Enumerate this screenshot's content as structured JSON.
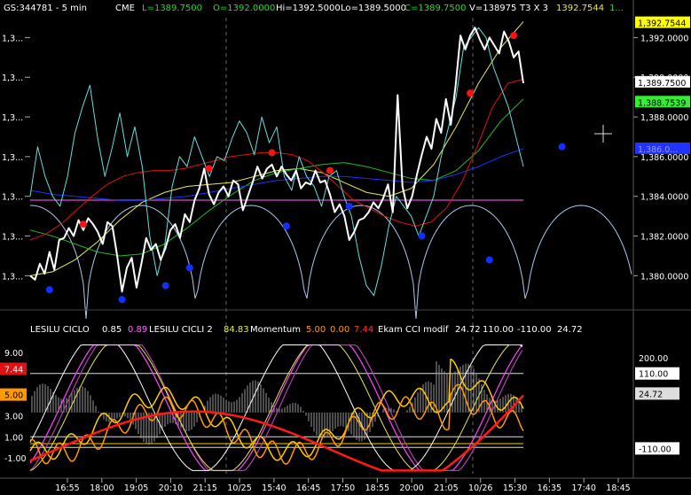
{
  "header": {
    "symbol": "GS:344781 - 5 min",
    "exchange": "CME",
    "last": "L=1389.7500",
    "open": "O=1392.0000",
    "high": "Hi=1392.5000",
    "low": "Lo=1389.5000",
    "close": "C=1389.7500",
    "volume": "V=138975",
    "t3": "T3 X 3",
    "t3_value": "1392.7544",
    "extra": "1..."
  },
  "indicator_header": {
    "ciclo_name": "LESILU CICLO",
    "ciclo_v1": "0.85",
    "ciclo_v2": "0.89",
    "cicli2_name": "LESILU CICLI 2",
    "cicli2_v": "84.83",
    "momentum_name": "Momentum",
    "momentum_v1": "5.00",
    "momentum_v2": "0.00",
    "momentum_v3": "7.44",
    "cci_name": "Ekam CCI modif",
    "cci_v1": "24.72",
    "cci_v2": "110.00",
    "cci_v3": "-110.00",
    "cci_v4": "24.72"
  },
  "colors": {
    "price": "#ffffff",
    "cyan": "#66dddd",
    "red": "#e01010",
    "blue": "#2030ff",
    "green": "#22bb22",
    "yellow": "#e8e850",
    "purple": "#b040b0",
    "arc": "#a8c8ec",
    "orange": "#ff9900",
    "gold": "#ffcc00",
    "magenta": "#ff44ff"
  },
  "chart_data": [
    {
      "type": "line",
      "title": "GS:344781 - 5 min",
      "x_ticks": [
        "16:55",
        "18:00",
        "19:05",
        "20:10",
        "21:15",
        "10/25",
        "15:40",
        "16:45",
        "17:50",
        "18:55",
        "20:00",
        "21:05",
        "10/26",
        "15:30",
        "16:35",
        "17:40",
        "18:45"
      ],
      "left_ticks": [
        "1,3...",
        "1,3...",
        "1,3...",
        "1,3...",
        "1,3...",
        "1,3...",
        "1,3..."
      ],
      "right_ticks": [
        "1,392.0000",
        "1,390.0000",
        "1,388.0000",
        "1,386.0000",
        "1,384.0000",
        "1,382.0000",
        "1,380.0000"
      ],
      "ylim": [
        1378.5,
        1393.0
      ],
      "horizontal_line": 1384.1,
      "price_labels": [
        {
          "text": "1,392.7544",
          "bg": "#ffff00",
          "fg": "#000000"
        },
        {
          "text": "1,389.7500",
          "bg": "#ffffff",
          "fg": "#000000"
        },
        {
          "text": "1,388.7539",
          "bg": "#33ee33",
          "fg": "#000000"
        },
        {
          "text": "1,386.0...",
          "bg": "#2233ff",
          "fg": "#9999ff"
        }
      ],
      "series": [
        {
          "name": "price",
          "values": [
            1380.0,
            1379.8,
            1380.6,
            1380.1,
            1381.2,
            1380.3,
            1381.8,
            1381.9,
            1382.4,
            1382.0,
            1382.8,
            1382.3,
            1382.9,
            1382.6,
            1382.2,
            1381.6,
            1382.7,
            1382.5,
            1381.0,
            1379.2,
            1380.4,
            1380.9,
            1379.4,
            1380.6,
            1381.9,
            1381.3,
            1381.6,
            1380.8,
            1381.4,
            1382.3,
            1382.6,
            1381.9,
            1383.1,
            1382.7,
            1383.8,
            1384.4,
            1385.4,
            1384.1,
            1383.6,
            1384.2,
            1384.5,
            1384.0,
            1384.8,
            1384.6,
            1383.3,
            1384.0,
            1384.7,
            1385.5,
            1384.9,
            1385.4,
            1385.6,
            1385.0,
            1385.5,
            1385.1,
            1384.8,
            1385.3,
            1384.4,
            1384.7,
            1384.6,
            1385.3,
            1384.7,
            1384.8,
            1384.1,
            1383.2,
            1383.6,
            1383.0,
            1381.8,
            1382.2,
            1382.8,
            1382.9,
            1383.2,
            1383.7,
            1383.4,
            1383.9,
            1384.6,
            1383.2,
            1389.1,
            1384.5,
            1383.4,
            1384.0,
            1385.1,
            1386.1,
            1387.0,
            1386.4,
            1387.9,
            1387.2,
            1388.9,
            1387.6,
            1389.6,
            1392.1,
            1391.4,
            1392.1,
            1392.5,
            1391.9,
            1391.4,
            1392.0,
            1391.6,
            1391.2,
            1392.3,
            1391.8,
            1391.0,
            1391.3,
            1389.7
          ]
        },
        {
          "name": "cyan",
          "values": [
            1384.0,
            1386.5,
            1385.0,
            1384.0,
            1383.5,
            1385.0,
            1387.2,
            1388.5,
            1389.6,
            1387.0,
            1385.0,
            1386.5,
            1388.2,
            1386.0,
            1387.5,
            1385.5,
            1382.0,
            1380.0,
            1381.5,
            1384.5,
            1386.0,
            1385.5,
            1387.0,
            1386.0,
            1385.0,
            1386.0,
            1385.8,
            1386.9,
            1387.8,
            1387.2,
            1386.1,
            1388.0,
            1386.7,
            1387.5,
            1385.0,
            1384.3,
            1386.0,
            1385.0,
            1384.5,
            1383.5,
            1385.0,
            1385.3,
            1384.0,
            1383.0,
            1381.0,
            1379.5,
            1379.0,
            1380.5,
            1382.5,
            1384.0,
            1383.5,
            1383.0,
            1382.0,
            1383.0,
            1384.0,
            1386.0,
            1387.5,
            1389.0,
            1391.5,
            1392.0,
            1392.5,
            1392.0,
            1390.5,
            1389.5,
            1388.5,
            1387.0,
            1385.5
          ]
        },
        {
          "name": "red",
          "values": [
            1381.8,
            1382.1,
            1382.6,
            1383.3,
            1384.0,
            1384.6,
            1385.0,
            1385.2,
            1385.3,
            1385.3,
            1385.4,
            1385.6,
            1385.8,
            1386.0,
            1386.1,
            1386.2,
            1386.2,
            1386.1,
            1385.8,
            1385.2,
            1384.5,
            1383.8,
            1383.4,
            1383.0,
            1382.7,
            1382.5,
            1382.7,
            1383.4,
            1384.7,
            1386.5,
            1388.5,
            1389.7,
            1389.9
          ]
        },
        {
          "name": "blue",
          "values": [
            1384.3,
            1384.1,
            1384.0,
            1383.9,
            1383.8,
            1383.8,
            1383.9,
            1384.0,
            1384.2,
            1384.4,
            1384.6,
            1384.8,
            1384.9,
            1385.0,
            1385.0,
            1384.9,
            1384.8,
            1384.7,
            1384.8,
            1385.1,
            1385.5,
            1386.0,
            1386.4
          ]
        },
        {
          "name": "green",
          "values": [
            1382.3,
            1382.0,
            1381.6,
            1381.2,
            1381.0,
            1381.1,
            1381.6,
            1382.4,
            1383.3,
            1384.1,
            1384.8,
            1385.2,
            1385.4,
            1385.6,
            1385.7,
            1385.5,
            1385.2,
            1384.9,
            1384.8,
            1385.3,
            1386.3,
            1387.8,
            1388.9
          ]
        },
        {
          "name": "yellow",
          "values": [
            1380.0,
            1380.2,
            1380.8,
            1381.7,
            1382.8,
            1383.7,
            1384.2,
            1384.5,
            1384.6,
            1384.7,
            1385.0,
            1385.3,
            1385.4,
            1385.2,
            1384.7,
            1384.2,
            1384.0,
            1384.4,
            1385.6,
            1387.5,
            1389.7,
            1391.5,
            1392.8
          ]
        }
      ],
      "markers": {
        "red_dots": [
          [
            11,
            1382.6
          ],
          [
            37,
            1385.4
          ],
          [
            50,
            1386.2
          ],
          [
            62,
            1385.3
          ],
          [
            91,
            1389.2
          ],
          [
            100,
            1392.1
          ]
        ],
        "blue_dots": [
          [
            4,
            1379.3
          ],
          [
            19,
            1378.8
          ],
          [
            28,
            1379.5
          ],
          [
            33,
            1380.4
          ],
          [
            53,
            1382.5
          ],
          [
            66,
            1383.5
          ],
          [
            81,
            1382.0
          ],
          [
            95,
            1380.8
          ],
          [
            110,
            1386.5
          ]
        ]
      }
    },
    {
      "type": "line",
      "title": "LESILU CICLO / Momentum / Ekam CCI modif",
      "left_labels": [
        {
          "text": "9.00",
          "fg": "#ffffff",
          "bg": ""
        },
        {
          "text": "7.44",
          "fg": "#ffffff",
          "bg": "#dd1111"
        },
        {
          "text": "5.00",
          "fg": "#000000",
          "bg": "#ff9900"
        },
        {
          "text": "3.00",
          "fg": "#ffffff",
          "bg": ""
        },
        {
          "text": "1.00",
          "fg": "#ffffff",
          "bg": ""
        },
        {
          "text": "-1.00",
          "fg": "#ffffff",
          "bg": ""
        }
      ],
      "right_labels": [
        {
          "text": "200.00",
          "fg": "#ffffff",
          "bg": ""
        },
        {
          "text": "110.00",
          "fg": "#000000",
          "bg": "#ffffff"
        },
        {
          "text": "24.72",
          "fg": "#000000",
          "bg": "#dddddd"
        },
        {
          "text": "-110.00",
          "fg": "#000000",
          "bg": "#ffffff"
        }
      ],
      "ylim": [
        -2.5,
        10.5
      ],
      "reference_lines": [
        7.0,
        1.0,
        0.0
      ]
    }
  ]
}
